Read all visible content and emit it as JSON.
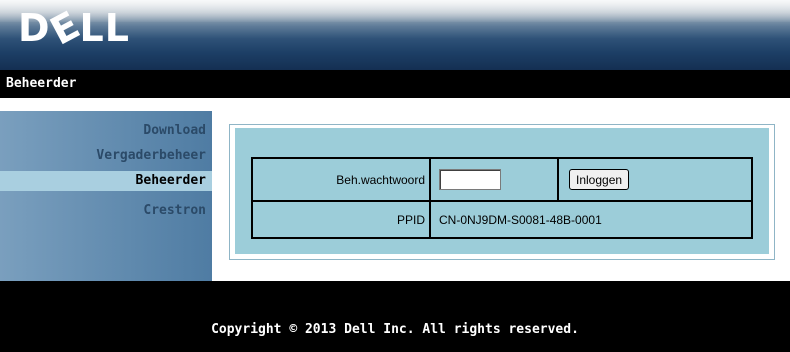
{
  "header": {
    "logo_text": "D",
    "logo_e": "E",
    "logo_rest": "LL"
  },
  "titlebar": {
    "title": "Beheerder"
  },
  "sidebar": {
    "items": [
      {
        "label": "Download"
      },
      {
        "label": "Vergaderbeheer"
      },
      {
        "label": "Beheerder"
      },
      {
        "label": "Crestron"
      }
    ]
  },
  "login_form": {
    "password_label": "Beh.wachtwoord",
    "password_value": "",
    "login_button": "Inloggen",
    "ppid_label": "PPID",
    "ppid_value": "CN-0NJ9DM-S0081-48B-0001"
  },
  "footer": {
    "copyright": "Copyright © 2013 Dell Inc. All rights reserved."
  },
  "colors": {
    "sidebar": "#4f7ca3",
    "active_item": "#a9cfe0",
    "panel": "#9ccdd9",
    "background": "#000000"
  }
}
